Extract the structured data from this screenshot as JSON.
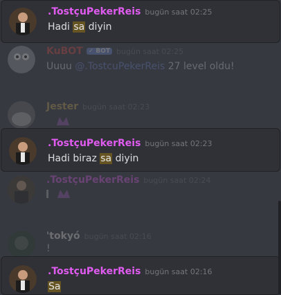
{
  "colors": {
    "background": "#36393f",
    "highlight_bg": "#2f3136",
    "user_tostcu": "#e05bf0",
    "user_kubot": "#d94b4b",
    "user_jester": "#c9a85c",
    "user_tokyo": "#e6e6e6",
    "timestamp": "#72767d",
    "mention": "#7289da",
    "keyword_highlight": "#665522"
  },
  "messages": [
    {
      "author": ".TostçuPekerReis",
      "time": "bugün saat 02:25",
      "pre": "Hadi ",
      "keyword": "sa",
      "post": " diyin",
      "highlighted": true
    },
    {
      "author": "KuBOT",
      "bot_tag": "✓ BOT",
      "time": "bugün saat 02:25",
      "pre": "Uuuu ",
      "mention": "@.TostcuPekerReis",
      "post": " 27 level oldu!",
      "highlighted": false
    },
    {
      "author": "Jester",
      "time": "bugün saat 02:23",
      "highlighted": false
    },
    {
      "author": ".TostçuPekerReis",
      "time": "bugün saat 02:23",
      "pre": "Hadi biraz ",
      "keyword": "sa",
      "post": " diyin",
      "highlighted": true
    },
    {
      "author": ".TostçuPekerReis",
      "time": "bugün saat 02:24",
      "highlighted": false
    },
    {
      "author": "'tokyó",
      "time": "bugün saat 02:16",
      "pre": "!",
      "highlighted": false
    },
    {
      "author": ".TostçuPekerReis",
      "time": "bugün saat 02:16",
      "keyword": "Sa",
      "highlighted": true
    }
  ]
}
